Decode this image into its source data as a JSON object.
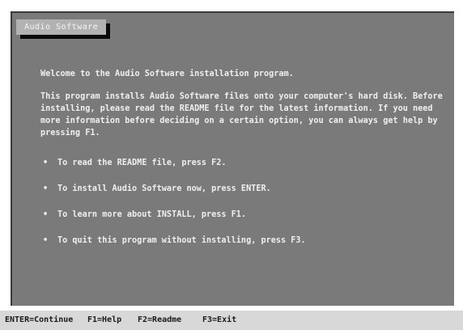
{
  "window": {
    "title": "Audio Software"
  },
  "content": {
    "welcome": "Welcome to the Audio Software installation program.",
    "description": "This program installs Audio Software files onto your computer's hard disk. Before installing, please read the README file for the latest information. If you need more information before deciding on a certain option, you can always get help by pressing F1.",
    "options": [
      {
        "bullet": "•",
        "label": "To read the README file, press F2."
      },
      {
        "bullet": "•",
        "label": "To install Audio Software now, press ENTER."
      },
      {
        "bullet": "•",
        "label": "To learn more about INSTALL, press F1."
      },
      {
        "bullet": "•",
        "label": "To quit this program without installing, press F3."
      }
    ]
  },
  "status_bar": {
    "items": [
      "ENTER=Continue",
      "F1=Help",
      "F2=Readme",
      "F3=Exit"
    ]
  }
}
